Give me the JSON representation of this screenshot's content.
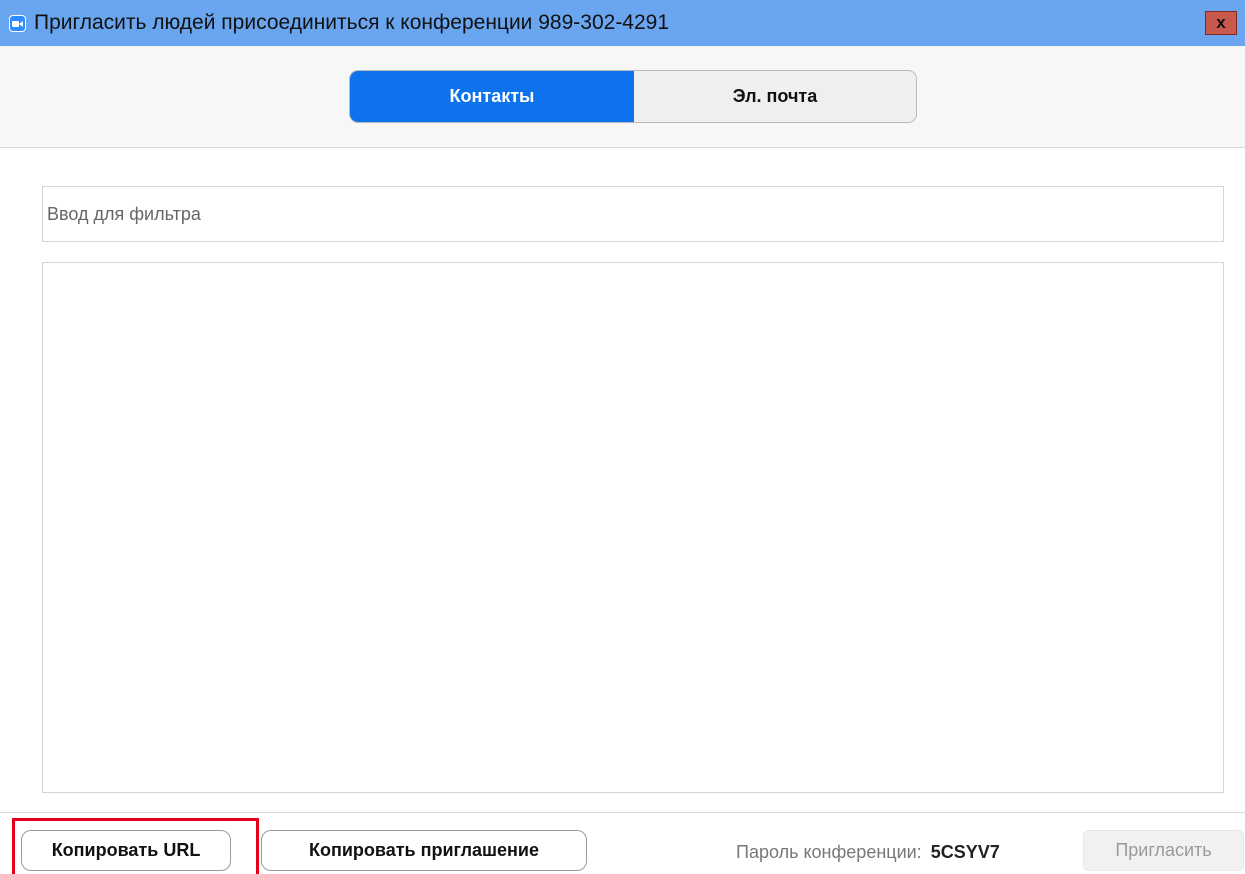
{
  "window": {
    "title": "Пригласить людей присоединиться к конференции 989-302-4291",
    "app_icon": "camera-icon",
    "close_label": "x"
  },
  "tabs": [
    {
      "label": "Контакты",
      "active": true
    },
    {
      "label": "Эл. почта",
      "active": false
    }
  ],
  "filter": {
    "placeholder": "Ввод для фильтра",
    "value": ""
  },
  "contacts": [],
  "footer": {
    "copy_url_label": "Копировать URL",
    "copy_invitation_label": "Копировать приглашение",
    "password_label": "Пароль конференции:",
    "password_value": "5CSYV7",
    "invite_label": "Пригласить",
    "invite_enabled": false
  },
  "colors": {
    "titlebar": "#6aa6f0",
    "accent": "#0e72ed",
    "close": "#c9594d",
    "highlight": "#e2001a"
  }
}
